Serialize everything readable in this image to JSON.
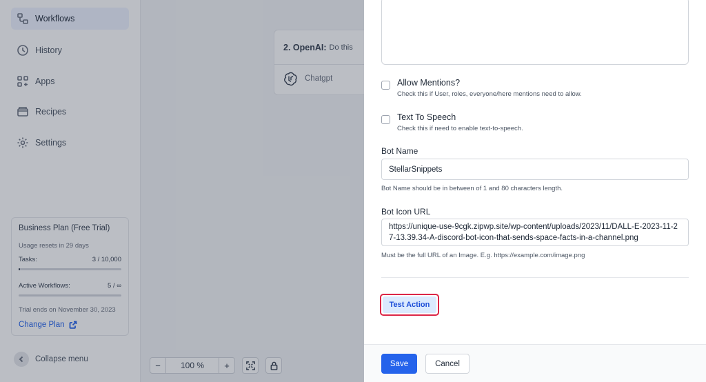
{
  "sidebar": {
    "items": [
      {
        "label": "Workflows",
        "icon": "workflow-icon",
        "active": true
      },
      {
        "label": "History",
        "icon": "clock-icon"
      },
      {
        "label": "Apps",
        "icon": "apps-grid-icon"
      },
      {
        "label": "Recipes",
        "icon": "recipe-icon"
      },
      {
        "label": "Settings",
        "icon": "gear-icon"
      }
    ],
    "plan": {
      "title": "Business Plan (Free Trial)",
      "usage_reset": "Usage resets in 29 days",
      "tasks_label": "Tasks:",
      "tasks_value": "3 / 10,000",
      "tasks_fraction": 0.0003,
      "active_workflows_label": "Active Workflows:",
      "active_workflows_value": "5 / ∞",
      "active_workflows_fraction": 0.0,
      "trial_end": "Trial ends on November 30, 2023",
      "change_plan": "Change Plan"
    },
    "collapse_label": "Collapse menu"
  },
  "canvas": {
    "step_title": "2. OpenAI:",
    "step_subtitle": "Do this",
    "step_app": "Chatgpt",
    "zoom_minus": "−",
    "zoom_value": "100 %",
    "zoom_plus": "+"
  },
  "panel": {
    "allow_mentions": {
      "label": "Allow Mentions?",
      "help": "Check this if User, roles, everyone/here mentions need to allow."
    },
    "tts": {
      "label": "Text To Speech",
      "help": "Check this if need to enable text-to-speech."
    },
    "bot_name": {
      "label": "Bot Name",
      "value": "StellarSnippets",
      "help": "Bot Name should be in between of 1 and 80 characters length."
    },
    "bot_icon": {
      "label": "Bot Icon URL",
      "value": "https://unique-use-9cgk.zipwp.site/wp-content/uploads/2023/11/DALL-E-2023-11-27-13.39.34-A-discord-bot-icon-that-sends-space-facts-in-a-channel.png",
      "help": "Must be the full URL of an Image. E.g. https://example.com/image.png"
    },
    "test_action": "Test Action",
    "save": "Save",
    "cancel": "Cancel"
  },
  "colors": {
    "primary": "#2563eb",
    "highlight_border": "#dc2647",
    "overlay": "rgba(30,41,59,0.30)"
  }
}
